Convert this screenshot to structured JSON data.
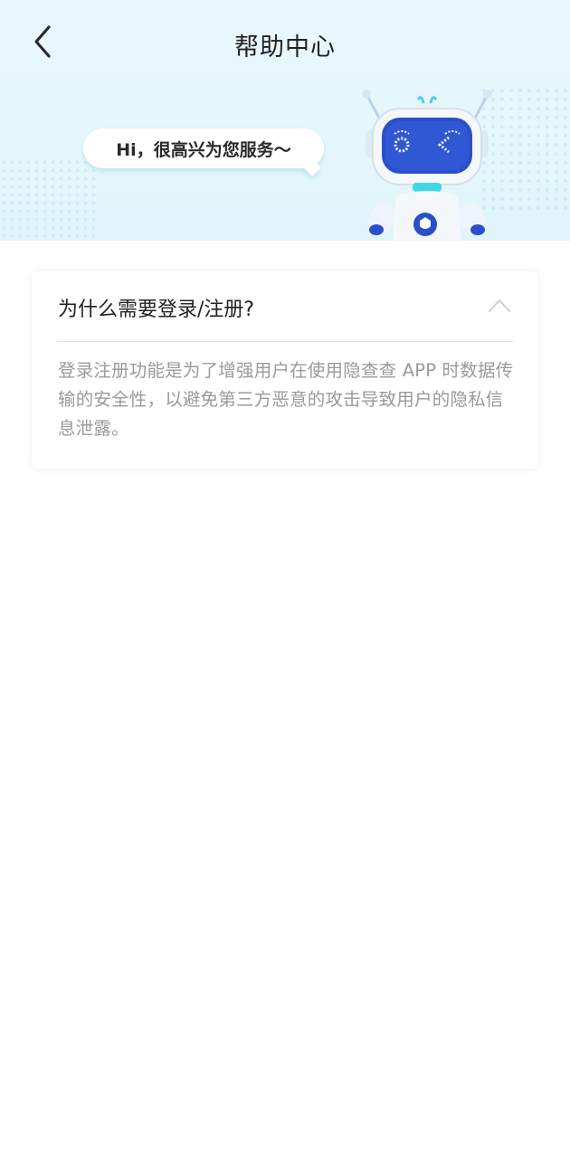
{
  "header": {
    "title": "帮助中心",
    "back_icon": "chevron-left-icon"
  },
  "hero": {
    "greeting": "Hi，很高兴为您服务～",
    "mascot": "robot-mascot"
  },
  "faq": {
    "items": [
      {
        "question": "为什么需要登录/注册?",
        "answer": "登录注册功能是为了增强用户在使用隐查查 APP 时数据传输的安全性，以避免第三方恶意的攻击导致用户的隐私信息泄露。",
        "expanded": true,
        "toggle_icon": "chevron-up-icon"
      }
    ]
  },
  "colors": {
    "hero_background": "#e6f7fc",
    "robot_screen": "#2b4fc9",
    "robot_accent": "#3fd6e6",
    "question_text": "#222222",
    "answer_text": "#9a9a9a"
  }
}
